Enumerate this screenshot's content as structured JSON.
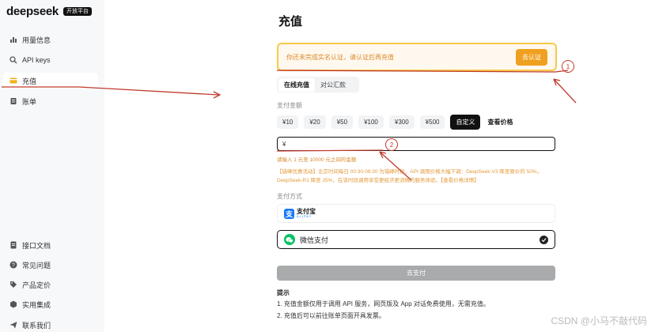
{
  "brand": {
    "name": "deepseek",
    "badge": "开放平台"
  },
  "sidebar": {
    "top_items": [
      {
        "label": "用量信息",
        "icon": "bar-chart-icon"
      },
      {
        "label": "API keys",
        "icon": "search-icon"
      },
      {
        "label": "充值",
        "icon": "wallet-icon",
        "active": true
      },
      {
        "label": "账单",
        "icon": "receipt-icon"
      }
    ],
    "bottom_items": [
      {
        "label": "接口文档",
        "icon": "document-icon"
      },
      {
        "label": "常见问题",
        "icon": "question-icon"
      },
      {
        "label": "产品定价",
        "icon": "tag-icon"
      },
      {
        "label": "实用集成",
        "icon": "cube-icon"
      },
      {
        "label": "联系我们",
        "icon": "send-icon"
      }
    ]
  },
  "page": {
    "title": "充值",
    "notice": {
      "text": "你还未完成实名认证，请认证后再充值",
      "button": "去认证"
    },
    "tabs": [
      {
        "label": "在线充值",
        "active": true
      },
      {
        "label": "对公汇款",
        "active": false
      }
    ],
    "amount_label": "支付金额",
    "amounts": [
      "¥10",
      "¥20",
      "¥50",
      "¥100",
      "¥300",
      "¥500"
    ],
    "custom_label": "自定义",
    "view_price_label": "查看价格",
    "input_prefix": "¥",
    "hint": "请输入 1 元至 10000 元之间的金额",
    "promo": "【错峰优惠活动】北京时间每日 00:30-08:30 为错峰时段，API 调用价格大幅下调：DeepSeek-V3 降至原价的 50%，DeepSeek-R1 降至 25%，在该时段调用享受更经济更流畅的服务体验。【查看价格详情】",
    "pay_method_label": "支付方式",
    "alipay": {
      "cn": "支付宝",
      "en": "ALIPAY"
    },
    "wechat_label": "微信支付",
    "submit": "去支付",
    "tips_title": "提示",
    "tips": [
      "1. 充值金额仅用于调用 API 服务，网页版及 App 对话免费使用，无需充值。",
      "2. 充值后可以前往账单页面开具发票。"
    ]
  },
  "annotations": {
    "marker1": "1",
    "marker2": "2",
    "color": "#c0392b"
  },
  "watermark": "CSDN @小马不敲代码",
  "colors": {
    "accent": "#f0a020",
    "warning_text": "#d98a2b",
    "wechat": "#07c160",
    "alipay": "#1677ff"
  }
}
